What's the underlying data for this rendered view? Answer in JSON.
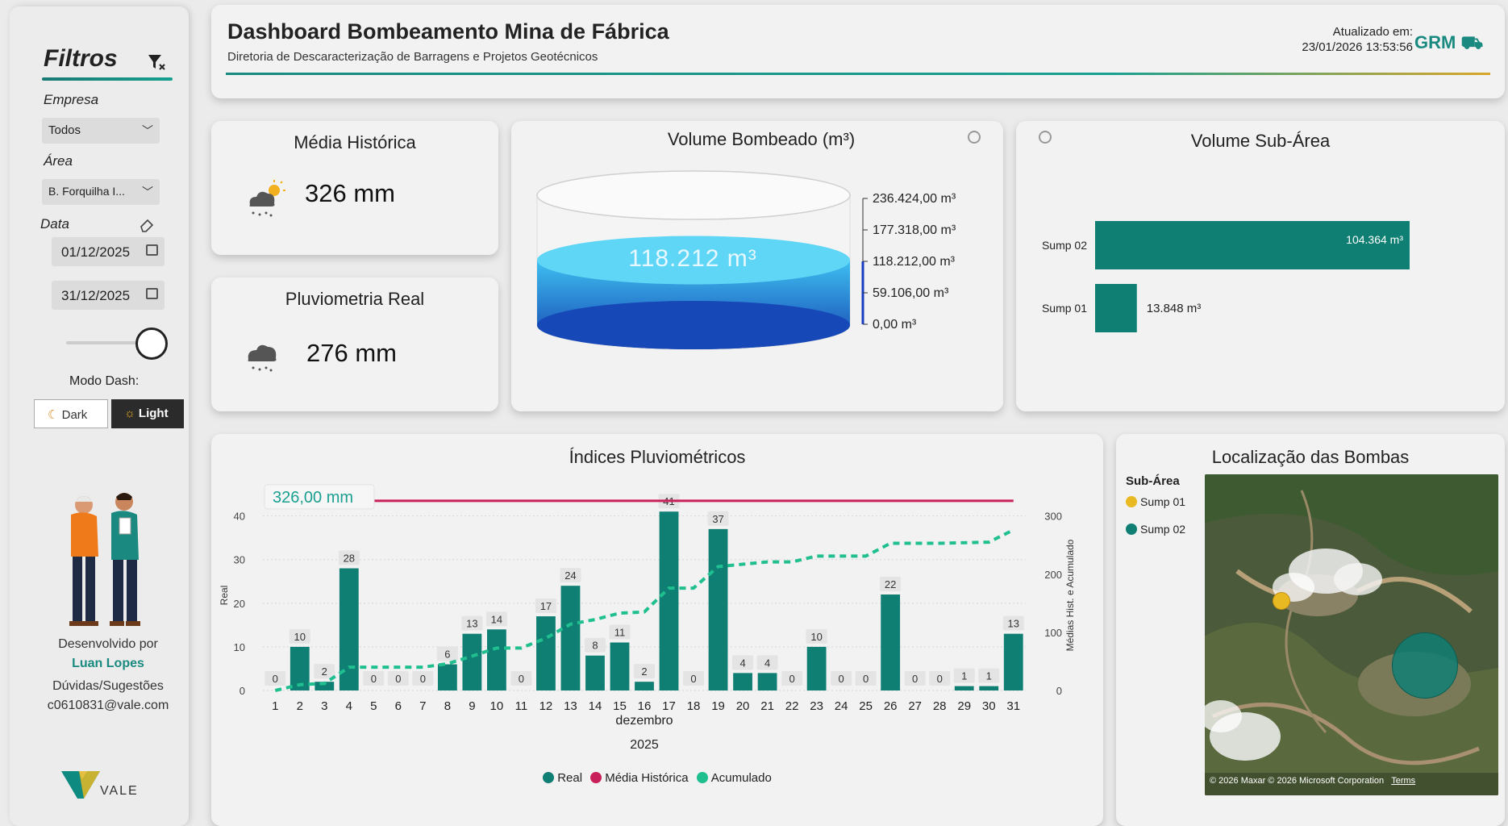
{
  "sidebar": {
    "title": "Filtros",
    "empresa_label": "Empresa",
    "empresa_value": "Todos",
    "area_label": "Área",
    "area_value": "B. Forquilha I...",
    "data_label": "Data",
    "date_start": "01/12/2025",
    "date_end": "31/12/2025",
    "mode_label": "Modo Dash:",
    "dark_label": "Dark",
    "light_label": "Light",
    "dev_by": "Desenvolvido por",
    "dev_name": "Luan Lopes",
    "doubts": "Dúvidas/Sugestões",
    "email": "c0610831@vale.com",
    "brand": "VALE"
  },
  "header": {
    "title": "Dashboard Bombeamento Mina de Fábrica",
    "subtitle": "Diretoria de Descaracterização de Barragens e Projetos Geotécnicos",
    "updated_label": "Atualizado em:",
    "updated_value": "23/01/2026 13:53:56",
    "logo": "GRM"
  },
  "kpis": {
    "media_title": "Média Histórica",
    "media_value": "326 mm",
    "pluv_title": "Pluviometria Real",
    "pluv_value": "276 mm"
  },
  "volume": {
    "title": "Volume Bombeado (m³)",
    "value": "118.212 m³",
    "fill_fraction": 0.5,
    "scale": [
      "236.424,00 m³",
      "177.318,00 m³",
      "118.212,00 m³",
      "59.106,00 m³",
      "0,00 m³"
    ]
  },
  "subarea": {
    "title": "Volume Sub-Área",
    "bars": [
      {
        "name": "Sump 02",
        "value": 104364,
        "label": "104.364 m³"
      },
      {
        "name": "Sump 01",
        "value": 13848,
        "label": "13.848 m³"
      }
    ]
  },
  "map": {
    "title": "Localização das Bombas",
    "legend_title": "Sub-Área",
    "legend": [
      {
        "name": "Sump 01",
        "color": "#e8b923"
      },
      {
        "name": "Sump 02",
        "color": "#0f7f73"
      }
    ],
    "attribution": "© 2026 Maxar © 2026 Microsoft Corporation",
    "terms": "Terms"
  },
  "chart_data": {
    "type": "bar",
    "title": "Índices Pluviométricos",
    "categories": [
      "1",
      "2",
      "3",
      "4",
      "5",
      "6",
      "7",
      "8",
      "9",
      "10",
      "11",
      "12",
      "13",
      "14",
      "15",
      "16",
      "17",
      "18",
      "19",
      "20",
      "21",
      "22",
      "23",
      "24",
      "25",
      "26",
      "27",
      "28",
      "29",
      "30",
      "31"
    ],
    "xlabel_month": "dezembro",
    "xlabel_year": "2025",
    "ylabel": "Real",
    "y2label": "Médias Hist. e Acumulado",
    "ylim": [
      0,
      44
    ],
    "y2lim": [
      0,
      330
    ],
    "yticks": [
      "0",
      "10",
      "20",
      "30",
      "40"
    ],
    "y2ticks": [
      "0",
      "100",
      "200",
      "300"
    ],
    "series": [
      {
        "name": "Real",
        "color": "#0f7f73",
        "values": [
          0,
          10,
          2,
          28,
          0,
          0,
          0,
          6,
          13,
          14,
          0,
          17,
          24,
          8,
          11,
          2,
          41,
          0,
          37,
          4,
          4,
          0,
          10,
          0,
          0,
          22,
          0,
          0,
          1,
          1,
          13
        ]
      },
      {
        "name": "Média Histórica",
        "color": "#c8205a",
        "values": [
          326,
          326,
          326,
          326,
          326,
          326,
          326,
          326,
          326,
          326,
          326,
          326,
          326,
          326,
          326,
          326,
          326,
          326,
          326,
          326,
          326,
          326,
          326,
          326,
          326,
          326,
          326,
          326,
          326,
          326,
          326
        ]
      },
      {
        "name": "Acumulado",
        "color": "#1fbf8f",
        "values": [
          0,
          10,
          12,
          40,
          40,
          40,
          40,
          46,
          59,
          73,
          73,
          90,
          114,
          122,
          133,
          135,
          176,
          176,
          213,
          217,
          221,
          221,
          231,
          231,
          231,
          253,
          253,
          253,
          254,
          255,
          276
        ]
      }
    ],
    "reference_label": "326,00 mm",
    "legend": [
      "Real",
      "Média Histórica",
      "Acumulado"
    ]
  }
}
